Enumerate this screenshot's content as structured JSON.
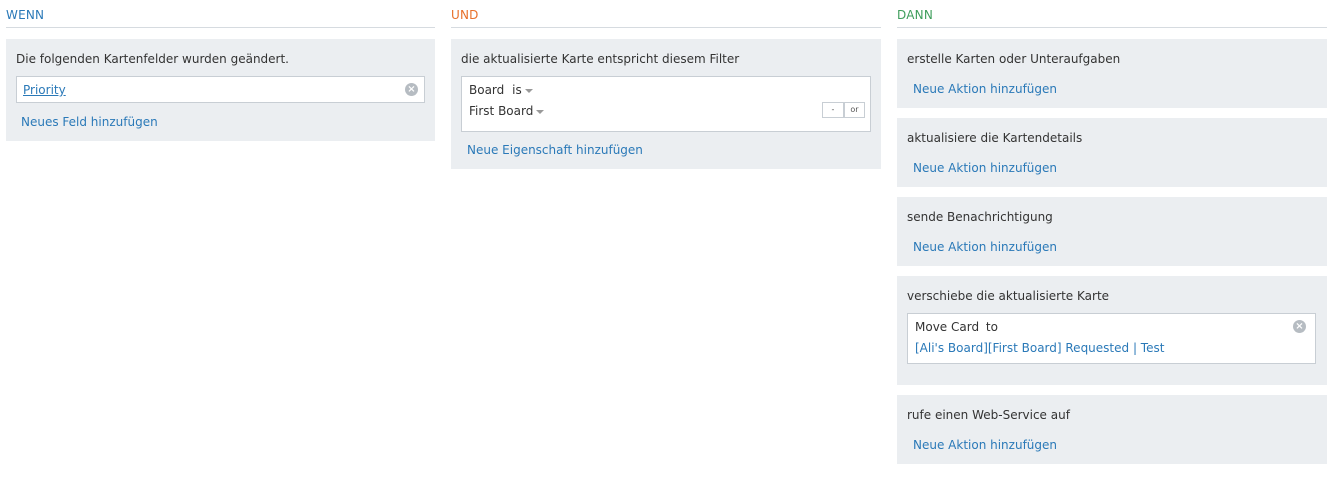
{
  "when": {
    "heading": "WENN",
    "panel_title": "Die folgenden Kartenfelder wurden geändert.",
    "field_value": "Priority",
    "add_field_link": "Neues Feld hinzufügen"
  },
  "and": {
    "heading": "UND",
    "panel_title": "die aktualisierte Karte entspricht diesem Filter",
    "filter": {
      "property": "Board",
      "operator": "is",
      "value": "First Board",
      "minus_label": "-",
      "or_label": "or"
    },
    "add_property_link": "Neue Eigenschaft hinzufügen"
  },
  "then": {
    "heading": "DANN",
    "sections": [
      {
        "title": "erstelle Karten oder Unteraufgaben",
        "add_action_link": "Neue Aktion hinzufügen"
      },
      {
        "title": "aktualisiere die Kartendetails",
        "add_action_link": "Neue Aktion hinzufügen"
      },
      {
        "title": "sende Benachrichtigung",
        "add_action_link": "Neue Aktion hinzufügen"
      },
      {
        "title": "verschiebe die aktualisierte Karte",
        "action": {
          "label": "Move Card",
          "to_label": "to",
          "target": "[Ali's Board][First Board] Requested | Test"
        }
      },
      {
        "title": "rufe einen Web-Service auf",
        "add_action_link": "Neue Aktion hinzufügen"
      }
    ]
  },
  "colors": {
    "when_heading": "#2a79b8",
    "and_heading": "#e8702a",
    "then_heading": "#3f9e5c",
    "link": "#2a79b8",
    "panel_bg": "#ebeef1"
  }
}
